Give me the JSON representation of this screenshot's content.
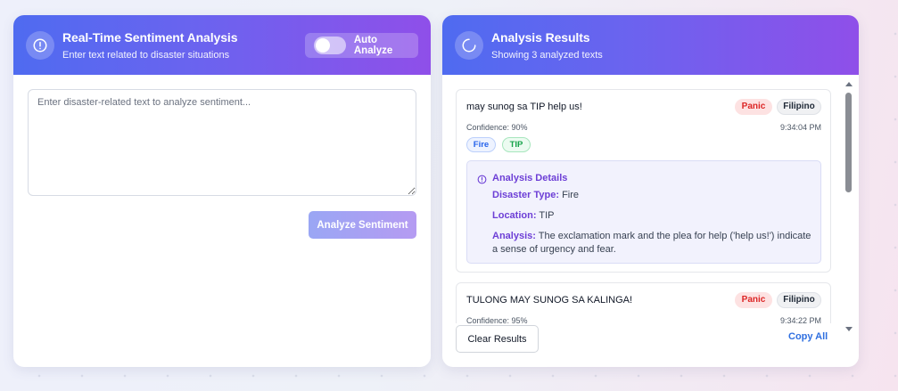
{
  "analysis_panel": {
    "title": "Real-Time Sentiment Analysis",
    "subtitle": "Enter text related to disaster situations",
    "icon": "alert-circle-icon",
    "auto_analyze": {
      "label": "Auto Analyze",
      "enabled": false
    },
    "input": {
      "placeholder": "Enter disaster-related text to analyze sentiment...",
      "value": ""
    },
    "analyze_button": "Analyze Sentiment"
  },
  "results_panel": {
    "title": "Analysis Results",
    "subtitle": "Showing 3 analyzed texts",
    "icon": "loader-icon",
    "results": [
      {
        "text": "may sunog sa TIP help us!",
        "sentiment": "Panic",
        "language": "Filipino",
        "confidence": "Confidence: 90%",
        "time": "9:34:04 PM",
        "tags": [
          "Fire",
          "TIP"
        ],
        "details": {
          "title": "Analysis Details",
          "disaster_type_label": "Disaster Type:",
          "disaster_type": "Fire",
          "location_label": "Location:",
          "location": "TIP",
          "analysis_label": "Analysis:",
          "analysis": "The exclamation mark and the plea for help ('help us!') indicate a sense of urgency and fear."
        }
      },
      {
        "text": "TULONG MAY SUNOG SA KALINGA!",
        "sentiment": "Panic",
        "language": "Filipino",
        "confidence": "Confidence: 95%",
        "time": "9:34:22 PM"
      }
    ],
    "clear_button": "Clear Results",
    "copy_button": "Copy All"
  },
  "colors": {
    "header_start": "#4f6bf0",
    "header_end": "#8f4fe9",
    "panic": "#dc2626",
    "accent_purple": "#6d3fd6",
    "link_blue": "#2f6fe0"
  }
}
